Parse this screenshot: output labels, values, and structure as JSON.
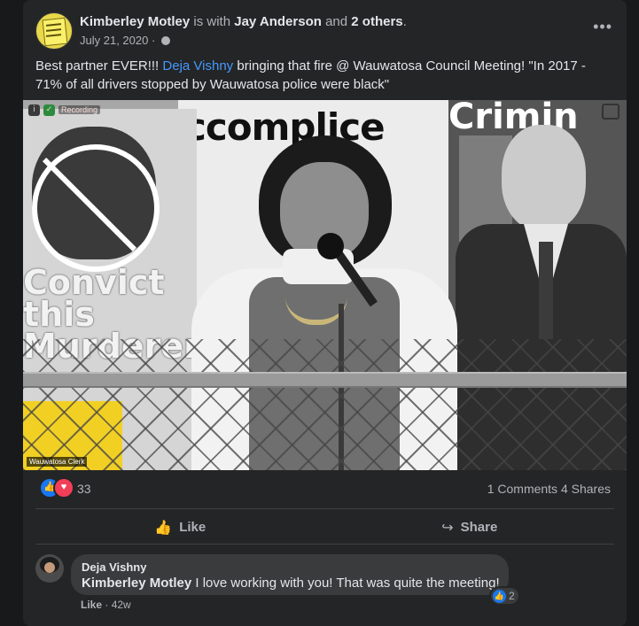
{
  "post": {
    "author": "Kimberley Motley",
    "with_text": "is with",
    "tagged": "Jay Anderson",
    "and_text": "and",
    "others": "2 others",
    "period": ".",
    "date": "July 21, 2020",
    "dot": "·",
    "more_label": "•••",
    "text_before": "Best partner EVER!!! ",
    "mention": "Deja Vishny",
    "text_after": " bringing that fire @ Wauwatosa Council Meeting!  \"In 2017 - 71% of all drivers stopped by Wauwatosa police were black\""
  },
  "video": {
    "recording_label": "Recording",
    "sign_left_text": "Convict this Murderer",
    "sign_mid_text": "ccomplice",
    "sign_right_text": "Crimin",
    "caption": "Wauwatosa Clerk",
    "info_icon": "i",
    "shield_icon": "✓"
  },
  "stats": {
    "reaction_count": "33",
    "comments": "1 Comments",
    "shares": "4 Shares",
    "like_glyph": "👍",
    "love_glyph": "♥"
  },
  "actions": {
    "like": "Like",
    "share": "Share",
    "like_icon": "👍",
    "share_icon": "↪"
  },
  "comment": {
    "author": "Deja Vishny",
    "mention": "Kimberley Motley",
    "text": " I love working with you! That was quite the meeting!",
    "reaction_count": "2",
    "like_label": "Like",
    "dot": "·",
    "age": "42w"
  },
  "colors": {
    "background": "#18191a",
    "card": "#242526",
    "link": "#4599ff",
    "like_blue": "#1877f2",
    "love_red": "#f33e58"
  }
}
